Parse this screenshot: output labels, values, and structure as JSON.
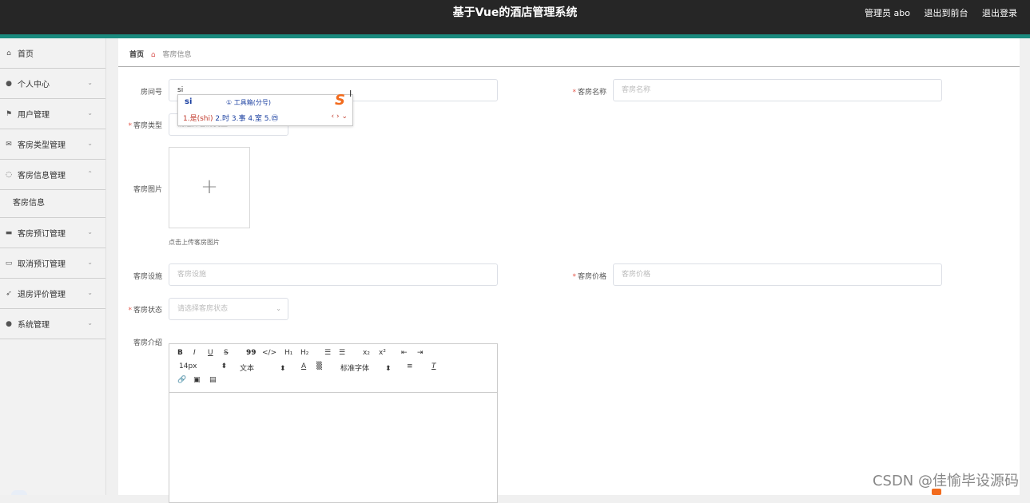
{
  "header": {
    "title": "基于Vue的酒店管理系统",
    "user": "管理员 abo",
    "to_front": "退出到前台",
    "logout": "退出登录"
  },
  "sidebar": {
    "items": [
      {
        "label": "首页",
        "icon": "home-icon",
        "chevron": ""
      },
      {
        "label": "个人中心",
        "icon": "user-icon",
        "chevron": "⌄"
      },
      {
        "label": "用户管理",
        "icon": "flag-icon",
        "chevron": "⌄"
      },
      {
        "label": "客房类型管理",
        "icon": "mail-icon",
        "chevron": "⌄"
      },
      {
        "label": "客房信息管理",
        "icon": "power-icon",
        "chevron": "⌃"
      },
      {
        "label": "客房预订管理",
        "icon": "ticket-icon",
        "chevron": "⌄"
      },
      {
        "label": "取消预订管理",
        "icon": "message-icon",
        "chevron": "⌄"
      },
      {
        "label": "退房评价管理",
        "icon": "send-icon",
        "chevron": "⌄"
      },
      {
        "label": "系统管理",
        "icon": "user-icon",
        "chevron": "⌄"
      }
    ],
    "sub_item": "客房信息"
  },
  "breadcrumb": {
    "home": "首页",
    "current": "客房信息"
  },
  "form": {
    "room_no": {
      "label": "房间号",
      "value": "si"
    },
    "room_name": {
      "label": "客房名称",
      "placeholder": "客房名称"
    },
    "room_type": {
      "label": "客房类型",
      "placeholder": "请选择客房类型"
    },
    "room_image": {
      "label": "客房图片",
      "hint": "点击上传客房图片"
    },
    "facilities": {
      "label": "客房设施",
      "placeholder": "客房设施"
    },
    "price": {
      "label": "客房价格",
      "placeholder": "客房价格"
    },
    "status": {
      "label": "客房状态",
      "placeholder": "请选择客房状态"
    },
    "intro": {
      "label": "客房介绍"
    }
  },
  "editor_toolbar": {
    "font_size": "14px",
    "text_type": "文本",
    "font_family": "标准字体"
  },
  "ime": {
    "pinyin": "si",
    "tool_hint": "① 工具箱(分号)",
    "candidates": [
      "1.是(shi)",
      "2.时",
      "3.事",
      "4.室",
      "5.㊃"
    ]
  },
  "watermark": "CSDN @佳愉毕设源码",
  "colors": {
    "header_bg": "#262626",
    "accent": "#1a8a7e",
    "required": "#e4574b"
  }
}
